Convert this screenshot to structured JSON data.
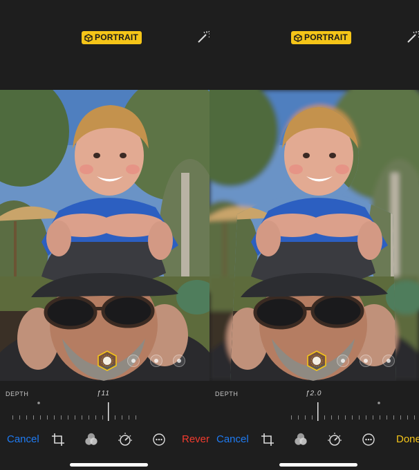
{
  "badge": {
    "label": "PORTRAIT",
    "color": "#f5c518"
  },
  "colors": {
    "accent_blue": "#1f7bf2",
    "revert_red": "#f23b2e",
    "done_yellow": "#f5c518"
  },
  "left": {
    "depth_label": "DEPTH",
    "f_value": "ƒ11",
    "toolbar": {
      "cancel": "Cancel",
      "right_action": "Revert"
    }
  },
  "right": {
    "depth_label": "DEPTH",
    "f_value": "ƒ2.0",
    "toolbar": {
      "cancel": "Cancel",
      "right_action": "Done"
    }
  },
  "icons": [
    "portrait-cube-icon",
    "magic-wand-icon",
    "crop-icon",
    "filters-icon",
    "adjust-dial-icon",
    "more-icon"
  ]
}
